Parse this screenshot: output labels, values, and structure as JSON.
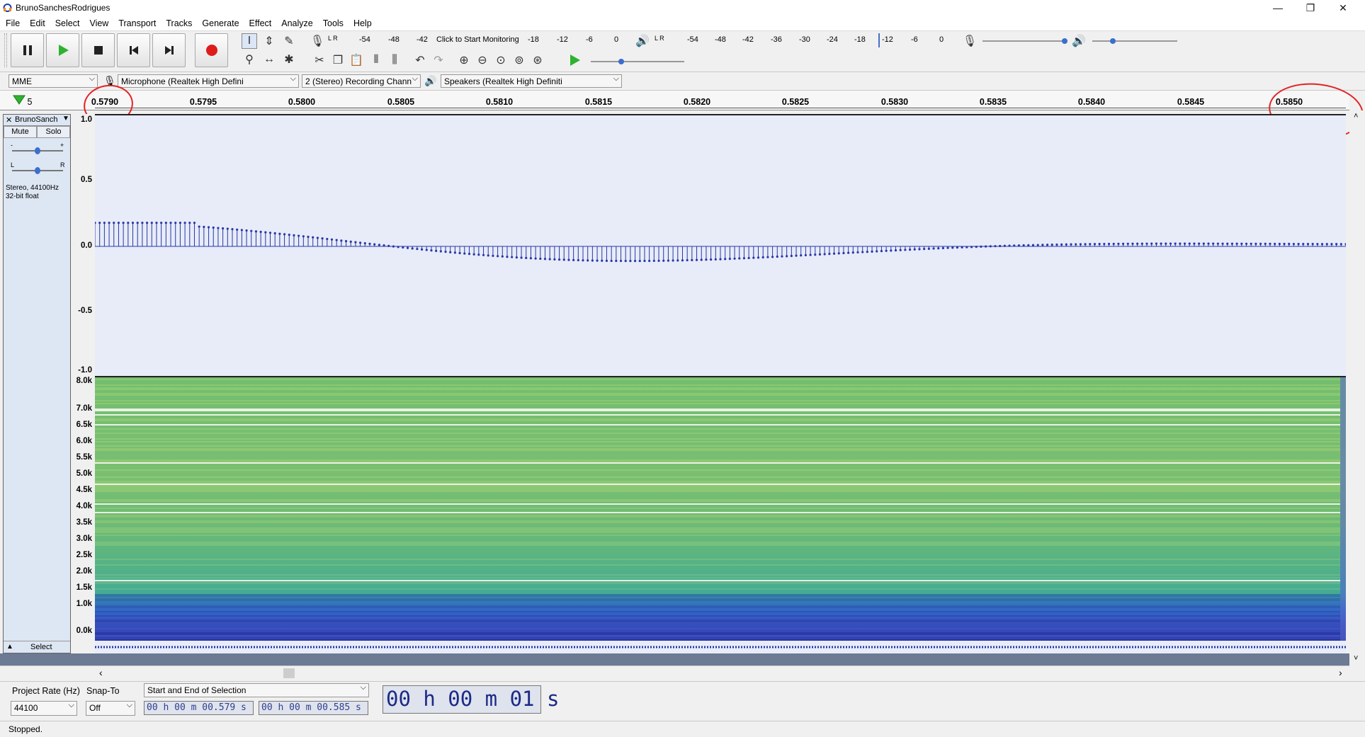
{
  "window": {
    "title": "BrunoSanchesRodrigues",
    "minimize": "—",
    "maximize": "❐",
    "close": "✕"
  },
  "menu": [
    "File",
    "Edit",
    "Select",
    "View",
    "Transport",
    "Tracks",
    "Generate",
    "Effect",
    "Analyze",
    "Tools",
    "Help"
  ],
  "meters": {
    "record_scale": [
      "-54",
      "-48",
      "-42",
      "Click to Start Monitoring",
      "-18",
      "-12",
      "-6",
      "0"
    ],
    "play_scale": [
      "-54",
      "-48",
      "-42",
      "-36",
      "-30",
      "-24",
      "-18",
      "-12",
      "-6",
      "0"
    ],
    "record_lr": "L\nR",
    "play_lr": "L\nR"
  },
  "devices": {
    "host": "MME",
    "recording_device": "Microphone (Realtek High Defini",
    "channels": "2 (Stereo) Recording Chann",
    "playback_device": "Speakers (Realtek High Definiti"
  },
  "ruler": {
    "labels": [
      "5",
      "0.5790",
      "0.5795",
      "0.5800",
      "0.5805",
      "0.5810",
      "0.5815",
      "0.5820",
      "0.5825",
      "0.5830",
      "0.5835",
      "0.5840",
      "0.5845",
      "0.5850"
    ]
  },
  "track": {
    "name": "BrunoSanch",
    "mute": "Mute",
    "solo": "Solo",
    "gain_minus": "-",
    "gain_plus": "+",
    "pan_left": "L",
    "pan_right": "R",
    "info_line1": "Stereo, 44100Hz",
    "info_line2": "32-bit float",
    "select": "Select",
    "collapse": "▲",
    "close": "✕"
  },
  "wave_axis": [
    "1.0",
    "0.5",
    "0.0",
    "-0.5",
    "-1.0"
  ],
  "spectro_axis": [
    "8.0k",
    "7.0k",
    "6.5k",
    "6.0k",
    "5.5k",
    "5.0k",
    "4.5k",
    "4.0k",
    "3.5k",
    "3.0k",
    "2.5k",
    "2.0k",
    "1.5k",
    "1.0k",
    "0.0k"
  ],
  "selection": {
    "project_rate_label": "Project Rate (Hz)",
    "project_rate": "44100",
    "snap_to_label": "Snap-To",
    "snap_to": "Off",
    "mode": "Start and End of Selection",
    "start": "00 h 00 m 00.579 s",
    "end": "00 h 00 m 00.585 s",
    "audio_position": "00 h 00 m 01 s"
  },
  "status": "Stopped.",
  "colors": {
    "waveform": "#2a37a8",
    "record": "#e01b1b",
    "play": "#2fb22f",
    "annotation": "#e52222"
  }
}
